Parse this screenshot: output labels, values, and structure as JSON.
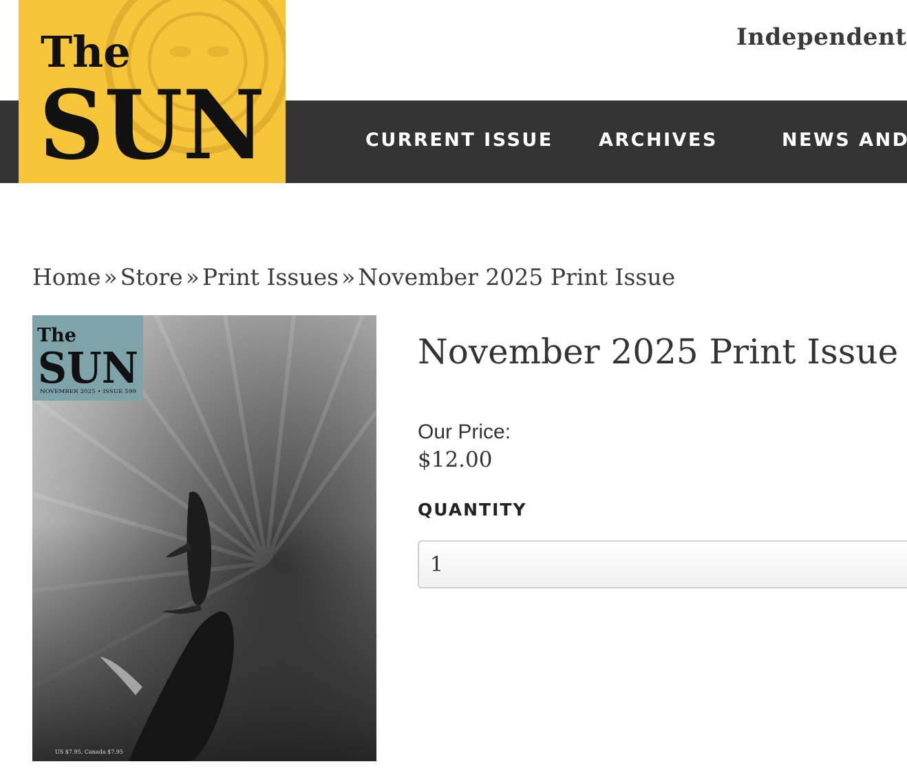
{
  "header": {
    "tagline": "Independent,",
    "logo": {
      "text_small": "The",
      "text_large": "SUN"
    },
    "nav": [
      "CURRENT ISSUE",
      "ARCHIVES",
      "NEWS AND"
    ]
  },
  "breadcrumb": {
    "items": [
      "Home",
      "Store",
      "Print Issues",
      "November 2025 Print Issue"
    ],
    "separator": "»"
  },
  "product": {
    "title": "November 2025 Print Issue",
    "price_label": "Our Price:",
    "price": "$12.00",
    "quantity_label": "QUANTITY",
    "quantity_value": "1",
    "cover": {
      "masthead_small": "The",
      "masthead_large": "SUN",
      "issue_line": "NOVEMBER 2025 • ISSUE 599",
      "price_line": "US $7.95, Canada $7.95"
    }
  },
  "colors": {
    "brand_yellow": "#f6c53a",
    "nav_bg": "#333333",
    "cover_masthead_bg": "#7ea3a8"
  }
}
